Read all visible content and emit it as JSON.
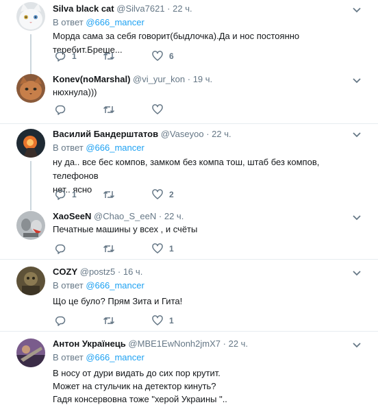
{
  "replies_label": "В ответ",
  "tweets": [
    {
      "name": "Silva black cat",
      "handle": "@Silva7621",
      "time": "22 ч.",
      "reply_to": "@666_mancer",
      "lines": [
        "Морда сама за себя говорит(быдлочка).Да и нос постоянно теребит.Бреше..."
      ],
      "counts": {
        "reply": "1",
        "retweet": "",
        "like": "6"
      }
    },
    {
      "name": "Konev(noMarshal)",
      "handle": "@vi_yur_kon",
      "time": "19 ч.",
      "reply_to": "",
      "lines": [
        "нюхнула)))"
      ],
      "counts": {
        "reply": "",
        "retweet": "",
        "like": ""
      }
    },
    {
      "name": "Василий Бандерштатов",
      "handle": "@Vaseyoo",
      "time": "22 ч.",
      "reply_to": "@666_mancer",
      "lines": [
        "ну да.. все бес компов, замком без компа тош, штаб без компов, телефонов",
        "нет.. ясно"
      ],
      "counts": {
        "reply": "1",
        "retweet": "",
        "like": "2"
      }
    },
    {
      "name": "XaoSeeN",
      "handle": "@Chao_S_eeN",
      "time": "22 ч.",
      "reply_to": "",
      "lines": [
        "Печатные машины у всех , и счёты"
      ],
      "counts": {
        "reply": "",
        "retweet": "",
        "like": "1"
      }
    },
    {
      "name": "COZY",
      "handle": "@postz5",
      "time": "16 ч.",
      "reply_to": "@666_mancer",
      "lines": [
        "Що це було? Прям Зита и Гита!"
      ],
      "counts": {
        "reply": "",
        "retweet": "",
        "like": "1"
      }
    },
    {
      "name": "Антон Украïнець",
      "handle": "@MBE1EwNonh2jmX7",
      "time": "22 ч.",
      "reply_to": "@666_mancer",
      "lines": [
        "В носу от дури видать до сих пор крутит.",
        "Может на стульчик на детектор кинуть?",
        "Гадя консервовна тоже \"херой Украины \".."
      ],
      "counts": {
        "reply": "",
        "retweet": "",
        "like": ""
      }
    }
  ]
}
